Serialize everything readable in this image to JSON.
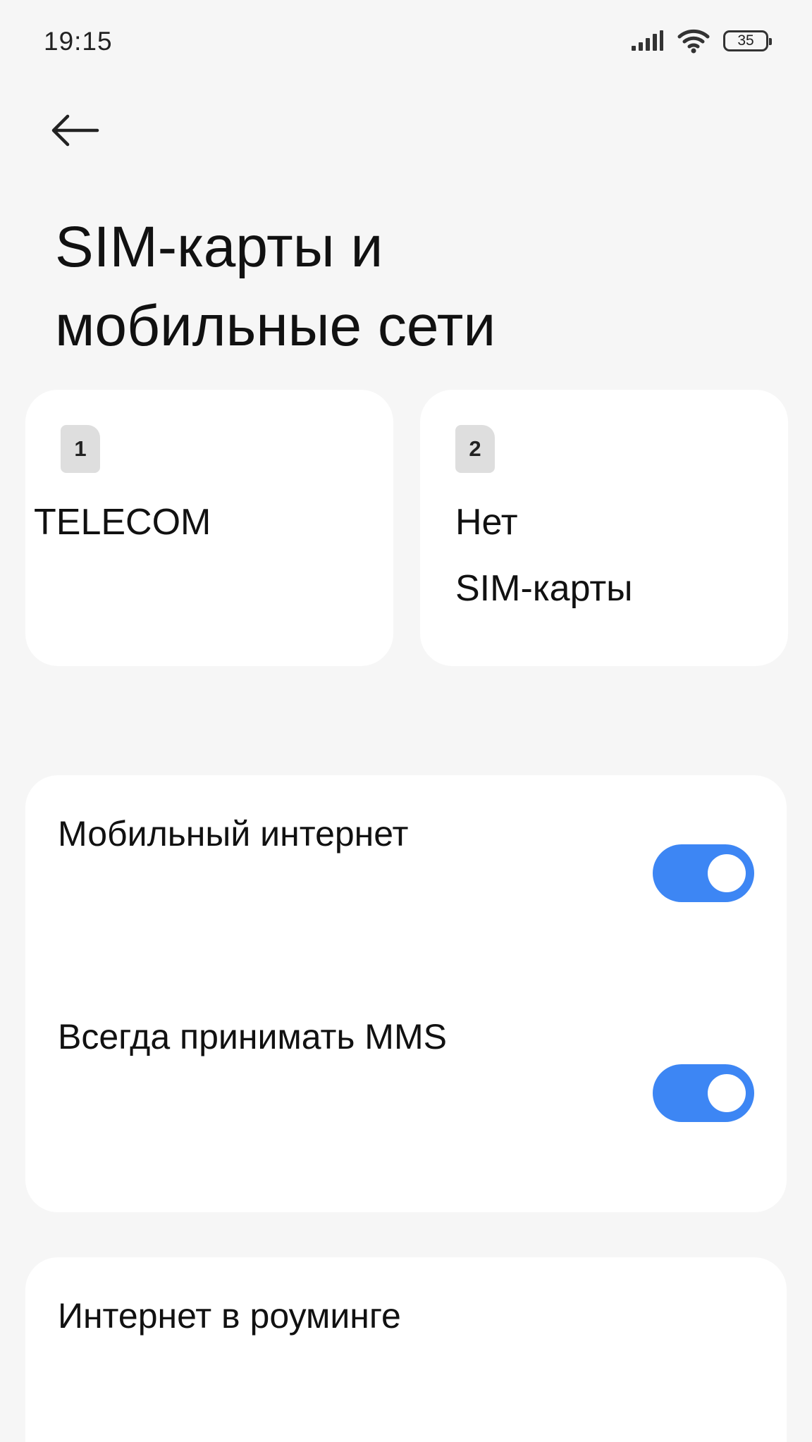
{
  "status_bar": {
    "time": "19:15",
    "battery_level": "35",
    "icons": [
      "signal-icon",
      "wifi-icon",
      "battery-icon"
    ]
  },
  "header": {
    "back_icon": "arrow-left-icon",
    "title_line1": "SIM-карты и",
    "title_line2": "мобильные сети"
  },
  "sim_cards": [
    {
      "slot": "1",
      "name": "TELECOM"
    },
    {
      "slot": "2",
      "name_line1": "Нет",
      "name_line2": "SIM-карты"
    }
  ],
  "settings": {
    "mobile_internet": {
      "label": "Мобильный интернет",
      "enabled": true
    },
    "always_receive_mms": {
      "label": "Всегда принимать MMS",
      "enabled": true
    },
    "roaming": {
      "label": "Интернет в роуминге"
    }
  },
  "colors": {
    "background": "#f6f6f6",
    "card": "#ffffff",
    "toggle_on": "#3d86f4",
    "sim_badge": "#dedede"
  }
}
